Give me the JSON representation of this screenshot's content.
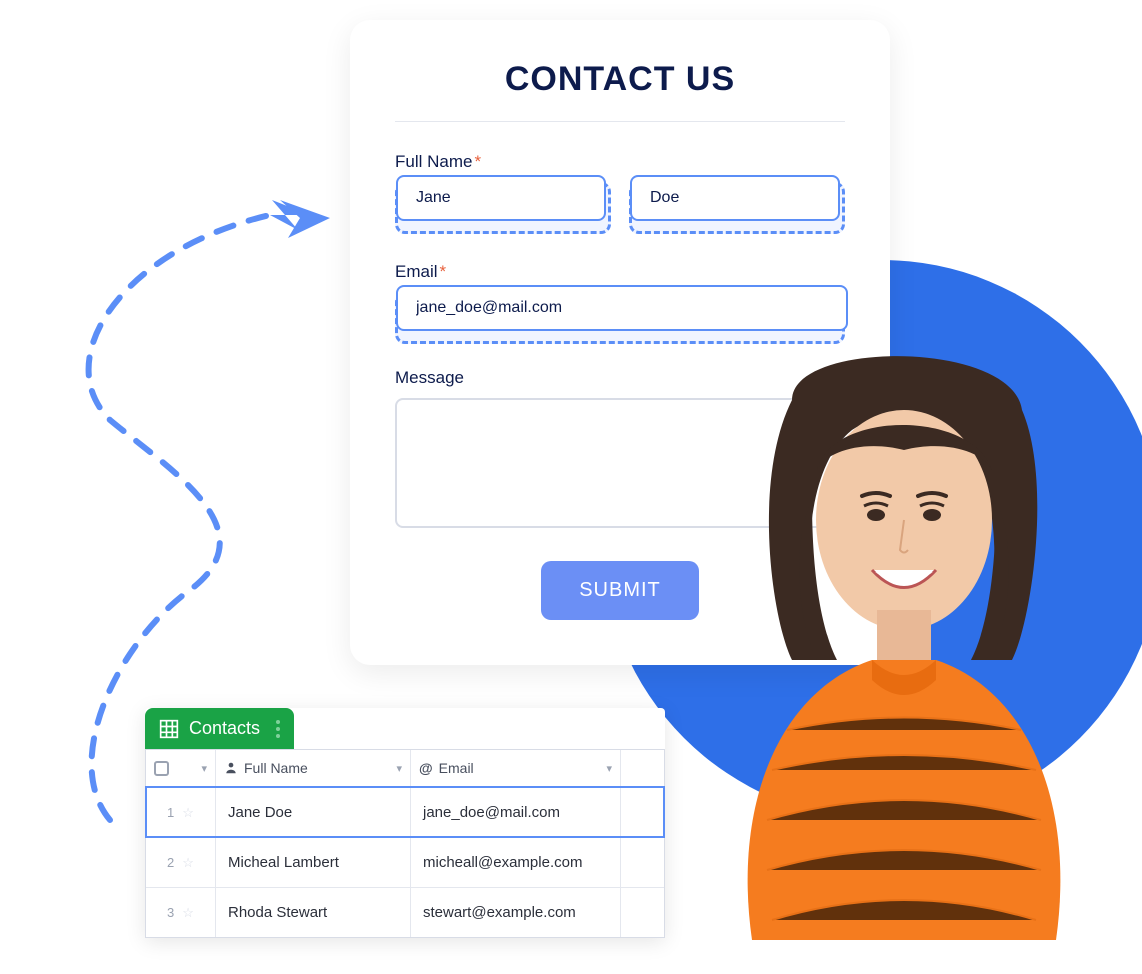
{
  "form": {
    "title": "CONTACT US",
    "fields": {
      "full_name_label": "Full Name",
      "first_name_value": "Jane",
      "last_name_value": "Doe",
      "email_label": "Email",
      "email_value": "jane_doe@mail.com",
      "message_label": "Message"
    },
    "submit_label": "SUBMIT"
  },
  "sheet": {
    "tab_label": "Contacts",
    "columns": {
      "full_name": "Full Name",
      "email": "Email"
    },
    "rows": [
      {
        "index": "1",
        "full_name": "Jane Doe",
        "email": "jane_doe@mail.com",
        "highlighted": true
      },
      {
        "index": "2",
        "full_name": "Micheal Lambert",
        "email": "micheall@example.com",
        "highlighted": false
      },
      {
        "index": "3",
        "full_name": "Rhoda Stewart",
        "email": "stewart@example.com",
        "highlighted": false
      }
    ]
  }
}
